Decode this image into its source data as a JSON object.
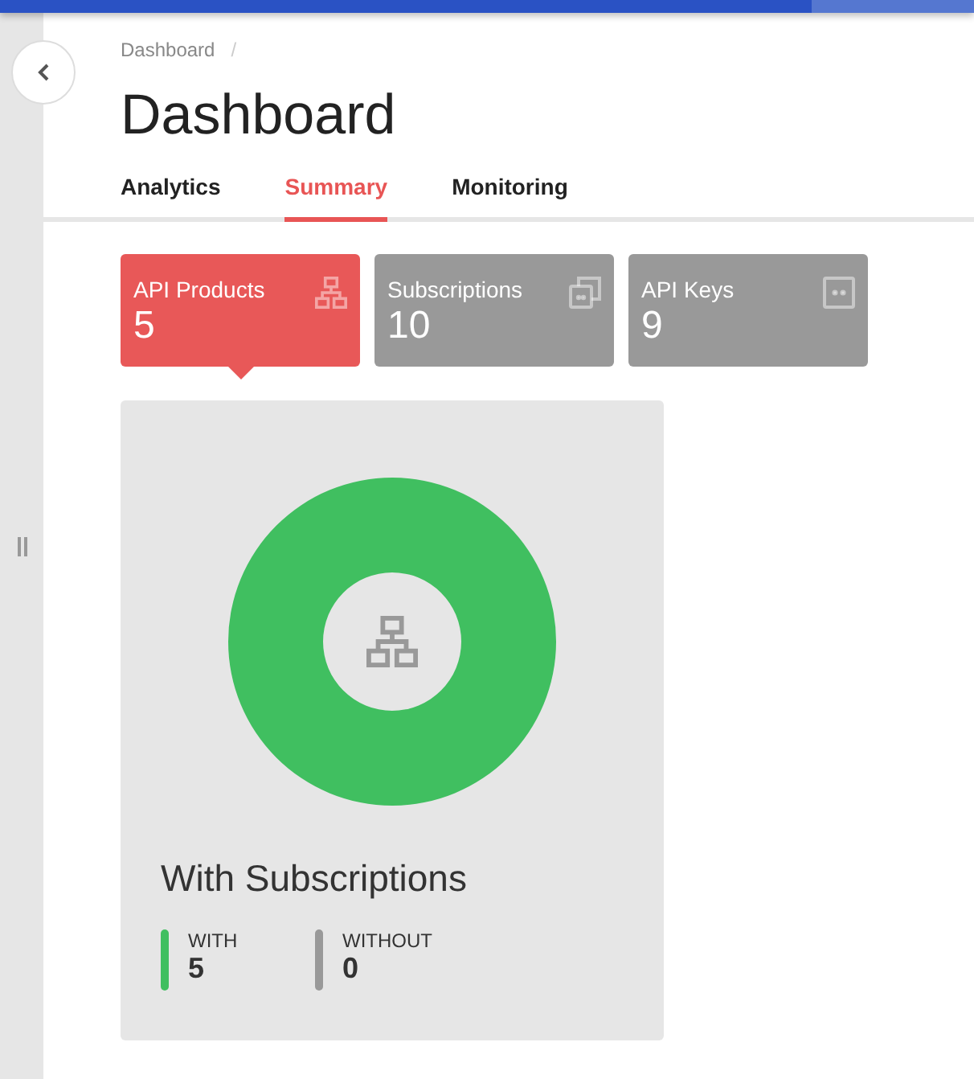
{
  "breadcrumb": {
    "items": [
      "Dashboard"
    ],
    "separator": "/"
  },
  "title": "Dashboard",
  "tabs": [
    {
      "label": "Analytics",
      "selected": false
    },
    {
      "label": "Summary",
      "selected": true
    },
    {
      "label": "Monitoring",
      "selected": false
    }
  ],
  "stat_cards": [
    {
      "label": "API Products",
      "value": "5",
      "selected": true,
      "kind": "products"
    },
    {
      "label": "Subscriptions",
      "value": "10",
      "selected": false,
      "kind": "subscriptions"
    },
    {
      "label": "API Keys",
      "value": "9",
      "selected": false,
      "kind": "keys"
    }
  ],
  "summary_card": {
    "title": "With Subscriptions",
    "legend": [
      {
        "label": "WITH",
        "value": "5",
        "color": "#40bf60"
      },
      {
        "label": "WITHOUT",
        "value": "0",
        "color": "#999999"
      }
    ]
  }
}
